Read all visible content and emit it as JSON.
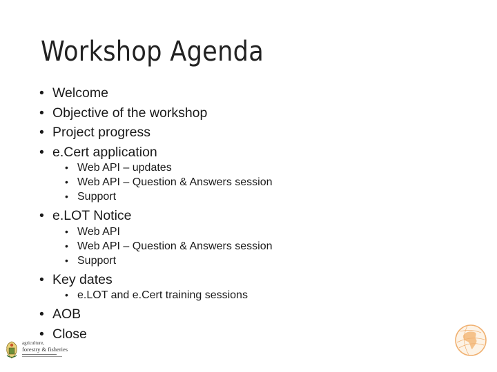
{
  "slide": {
    "title": "Workshop Agenda",
    "bullet_glyph": "•",
    "items": [
      {
        "label": "Welcome"
      },
      {
        "label": "Objective of the workshop"
      },
      {
        "label": "Project progress"
      },
      {
        "label": "e.Cert application",
        "children": [
          {
            "label": "Web API – updates"
          },
          {
            "label": "Web API – Question & Answers session"
          },
          {
            "label": "Support"
          }
        ]
      },
      {
        "label": "e.LOT Notice",
        "children": [
          {
            "label": "Web API"
          },
          {
            "label": "Web API – Question & Answers session"
          },
          {
            "label": "Support"
          }
        ]
      },
      {
        "label": "Key dates",
        "children": [
          {
            "label": "e.LOT and e.Cert training sessions"
          }
        ]
      },
      {
        "label": "AOB"
      },
      {
        "label": "Close"
      }
    ]
  },
  "footer": {
    "logo_left": {
      "line1": "agriculture,",
      "line2": "forestry & fisheries",
      "icon": "coat-of-arms-icon"
    },
    "logo_right": {
      "icon": "globe-icon",
      "color": "#f0a860"
    }
  }
}
